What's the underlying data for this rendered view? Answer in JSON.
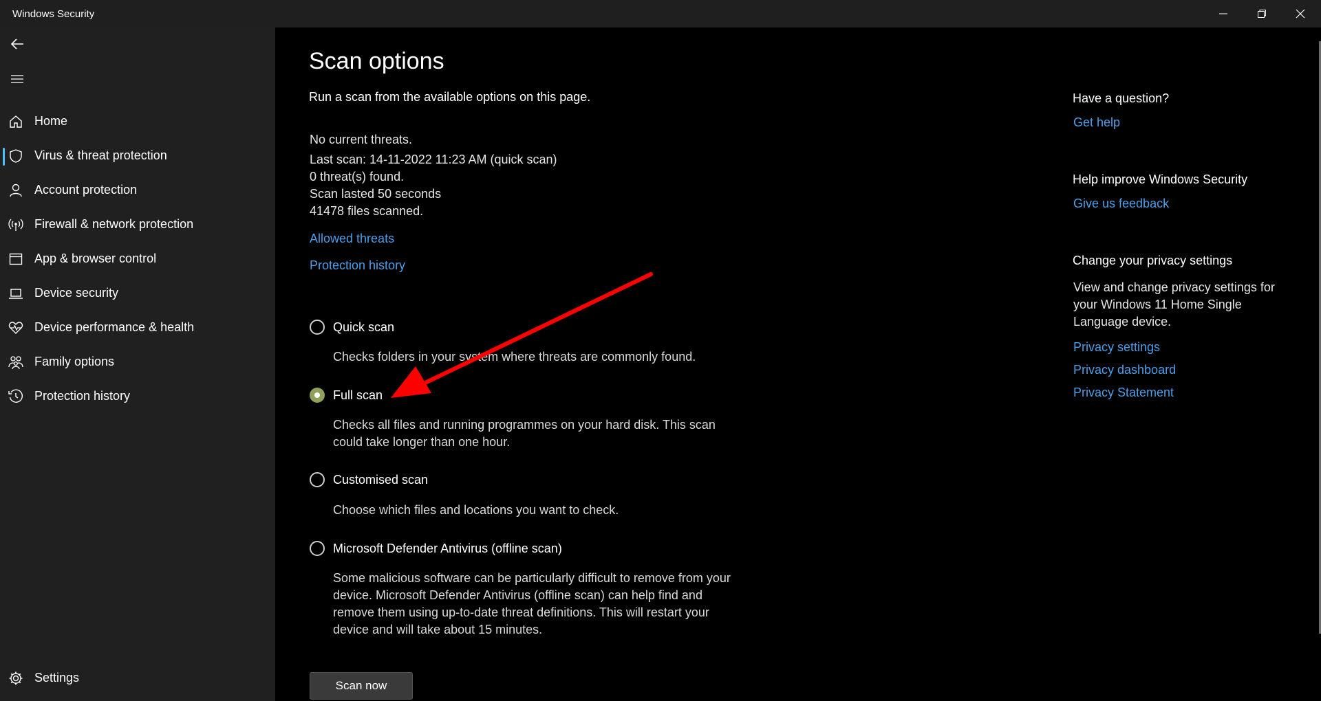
{
  "window": {
    "title": "Windows Security",
    "controls": [
      "minimize-icon",
      "restore-icon",
      "close-icon"
    ]
  },
  "sidebar": {
    "back_icon": "back-arrow-icon",
    "menu_icon": "hamburger-menu-icon",
    "items": [
      {
        "label": "Home",
        "icon": "home-icon",
        "active": false
      },
      {
        "label": "Virus & threat protection",
        "icon": "shield-icon",
        "active": true
      },
      {
        "label": "Account protection",
        "icon": "person-icon",
        "active": false
      },
      {
        "label": "Firewall & network protection",
        "icon": "antenna-icon",
        "active": false
      },
      {
        "label": "App & browser control",
        "icon": "app-window-icon",
        "active": false
      },
      {
        "label": "Device security",
        "icon": "laptop-icon",
        "active": false
      },
      {
        "label": "Device performance & health",
        "icon": "heart-pulse-icon",
        "active": false
      },
      {
        "label": "Family options",
        "icon": "family-icon",
        "active": false
      },
      {
        "label": "Protection history",
        "icon": "history-icon",
        "active": false
      }
    ],
    "settings": {
      "label": "Settings",
      "icon": "gear-icon"
    },
    "active_indicator_color": "#4cc2ff"
  },
  "main": {
    "title": "Scan options",
    "subtitle": "Run a scan from the available options on this page.",
    "status": {
      "threats": "No current threats.",
      "last_scan": "Last scan: 14-11-2022 11:23 AM (quick scan)",
      "threats_found": "0 threat(s) found.",
      "duration": "Scan lasted 50 seconds",
      "files_scanned": "41478 files scanned."
    },
    "links": {
      "allowed_threats": "Allowed threats",
      "protection_history": "Protection history"
    },
    "options": [
      {
        "label": "Quick scan",
        "description": "Checks folders in your system where threats are commonly found.",
        "selected": false
      },
      {
        "label": "Full scan",
        "description": "Checks all files and running programmes on your hard disk. This scan could take longer than one hour.",
        "selected": true
      },
      {
        "label": "Customised scan",
        "description": "Choose which files and locations you want to check.",
        "selected": false
      },
      {
        "label": "Microsoft Defender Antivirus (offline scan)",
        "description": "Some malicious software can be particularly difficult to remove from your device. Microsoft Defender Antivirus (offline scan) can help find and remove them using up-to-date threat definitions. This will restart your device and will take about 15 minutes.",
        "selected": false
      }
    ],
    "scan_button": "Scan now"
  },
  "right_panel": {
    "question": {
      "heading": "Have a question?",
      "link": "Get help"
    },
    "improve": {
      "heading": "Help improve Windows Security",
      "link": "Give us feedback"
    },
    "privacy": {
      "heading": "Change your privacy settings",
      "text": "View and change privacy settings for your Windows 11 Home Single Language device.",
      "links": [
        "Privacy settings",
        "Privacy dashboard",
        "Privacy Statement"
      ]
    }
  },
  "colors": {
    "link": "#4c9fe8",
    "selected_radio": "#8fa05a",
    "annotation_arrow": "#ff0000"
  }
}
